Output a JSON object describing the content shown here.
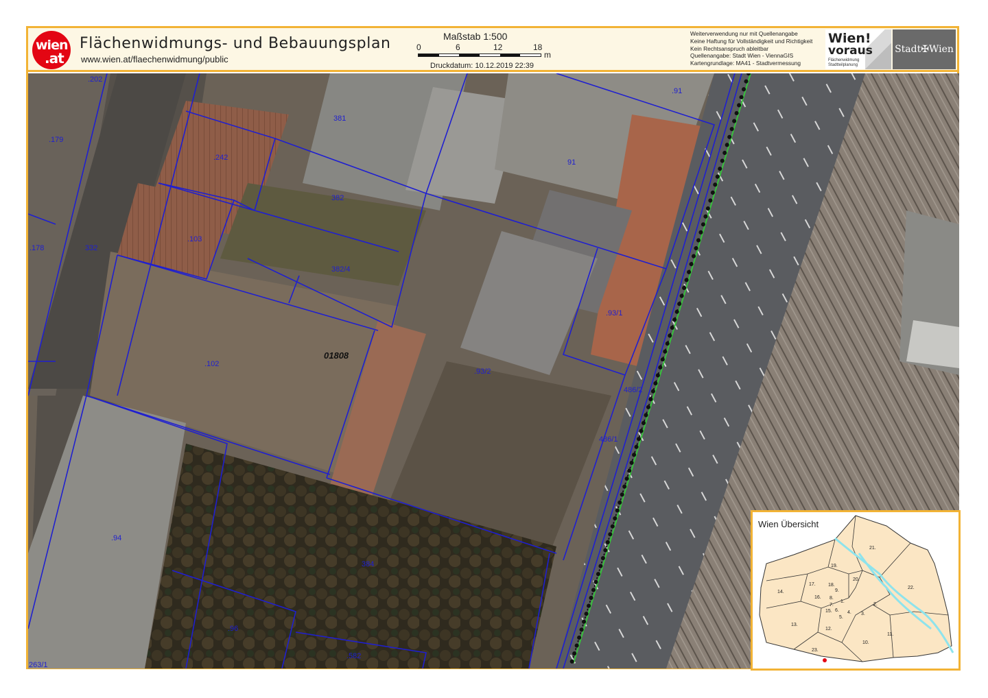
{
  "header": {
    "logo_line1": "wien",
    "logo_line2": ".at",
    "title": "Flächenwidmungs- und Bebauungsplan",
    "url": "www.wien.at/flaechenwidmung/public",
    "scale_title": "Maßstab 1:500",
    "scale_ticks": [
      "0",
      "6",
      "12",
      "18"
    ],
    "scale_unit": "m",
    "print_date": "Druckdatum: 10.12.2019 22:39",
    "disclaimer": [
      "Weiterverwendung nur mit Quellenangabe",
      "Keine Haftung für Vollständigkeit und Richtigkeit",
      "Kein Rechtsanspruch ableitbar",
      "Quellenangabe: Stadt Wien - ViennaGIS",
      "Kartengrundlage: MA41 - Stadtvermessung"
    ],
    "brand_wien": "Wien!",
    "brand_voraus": "voraus",
    "brand_sub1": "Flächenwidmung",
    "brand_sub2": "Stadtteilplanung",
    "stadt_wien": "Stadt✠Wien"
  },
  "map": {
    "block_number": "01808",
    "parcels": [
      ".202",
      ".179",
      ".178",
      "332",
      ".242",
      ".103",
      "381",
      "382",
      "382/4",
      ".102",
      "91",
      ".91",
      ".93/1",
      ".93/2",
      "486/2",
      "486/1",
      ".94",
      "384",
      ".96",
      ".582",
      "263/1"
    ],
    "colors": {
      "parcel_line": "#1f1fd0",
      "frame": "#f2b335",
      "rail_line": "#111111",
      "green_line": "#36c43a"
    }
  },
  "inset": {
    "title": "Wien Übersicht",
    "districts": [
      "21.",
      "19.",
      "20.",
      "18.",
      "17.",
      "9.",
      "22.",
      "14.",
      "16.",
      "8.",
      "1.",
      "2.",
      "15.",
      "7.",
      "6.",
      "4.",
      "3.",
      "5.",
      "13.",
      "12.",
      "11.",
      "10.",
      "23."
    ],
    "colors": {
      "fill": "#fbe6c4",
      "danube": "#8ee3ec",
      "location_marker": "#e30613"
    }
  }
}
